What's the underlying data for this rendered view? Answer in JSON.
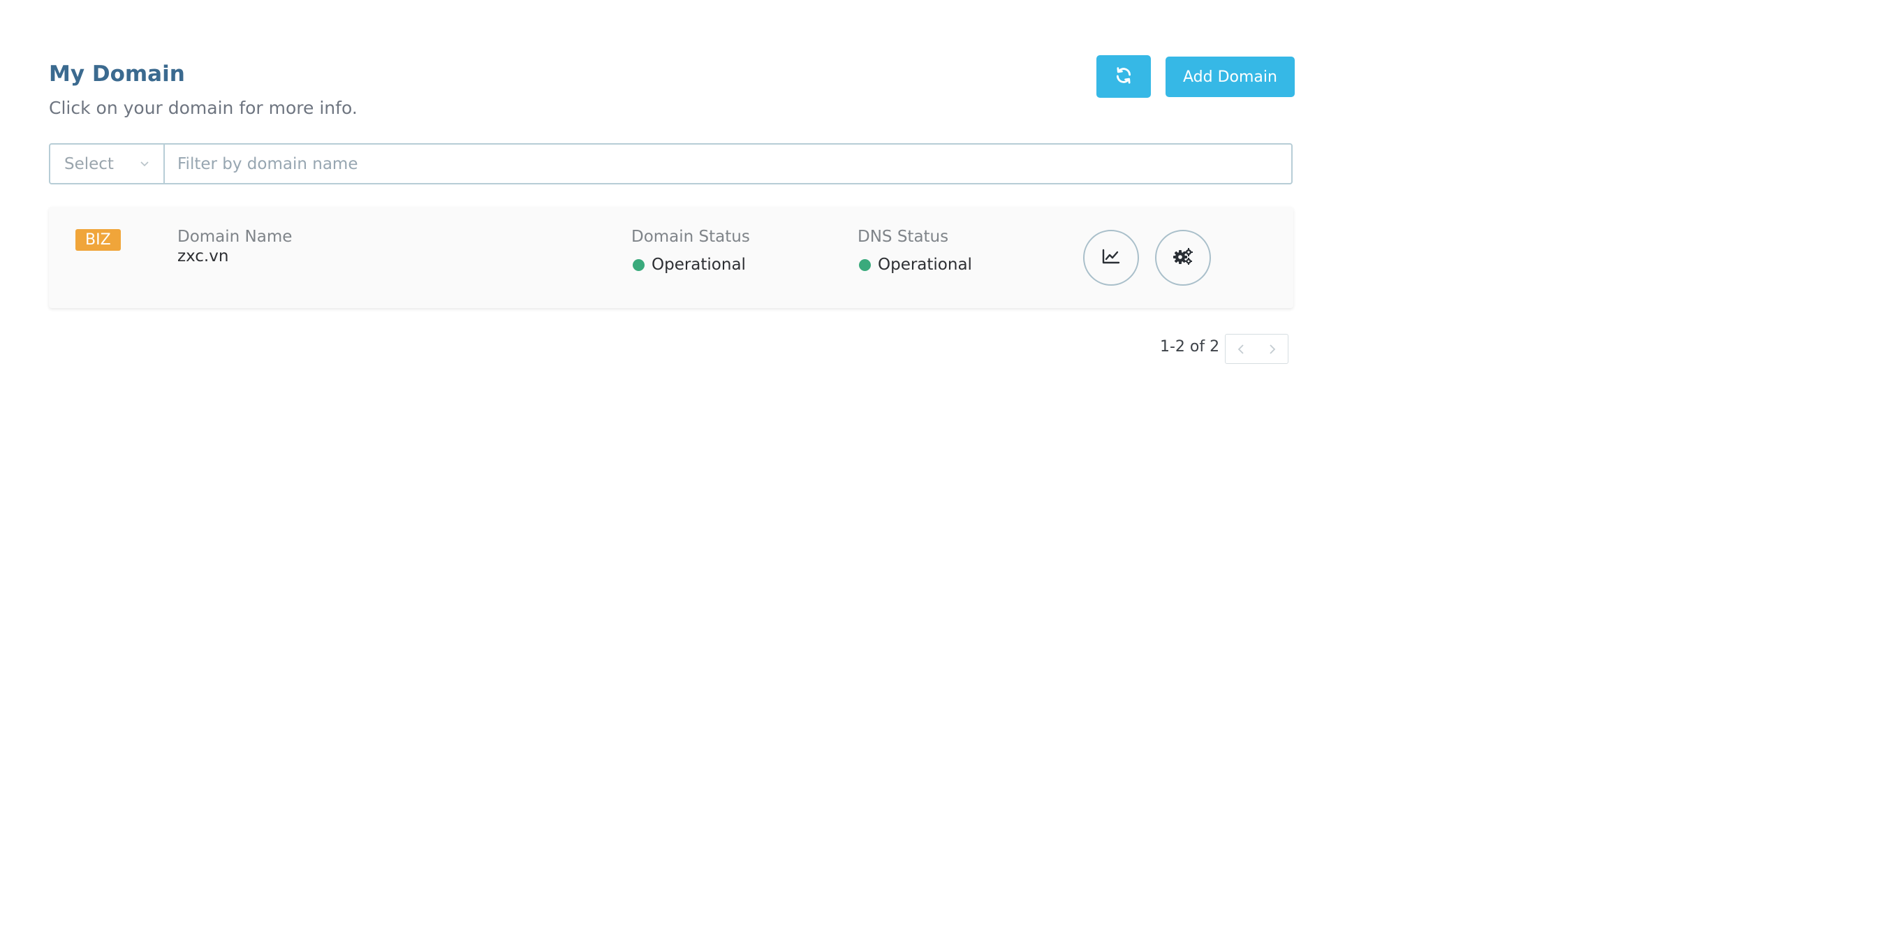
{
  "header": {
    "title": "My Domain",
    "subtitle": "Click on your domain for more info."
  },
  "toolbar": {
    "refresh_icon": "refresh-icon",
    "add_label": "Add Domain"
  },
  "filter": {
    "select_label": "Select",
    "placeholder": "Filter by domain name"
  },
  "domains": [
    {
      "tld_badge": "BIZ",
      "name_label": "Domain Name",
      "name": "zxc.vn",
      "domain_status_label": "Domain Status",
      "domain_status": "Operational",
      "dns_status_label": "DNS Status",
      "dns_status": "Operational",
      "actions": [
        "chart-icon",
        "gears-icon"
      ]
    }
  ],
  "pagination": {
    "range_text": "1-2 of 2"
  },
  "colors": {
    "accent": "#36b8e6",
    "title": "#3b6a8f",
    "badge": "#f0a53a",
    "status_ok": "#3aaa7c"
  }
}
